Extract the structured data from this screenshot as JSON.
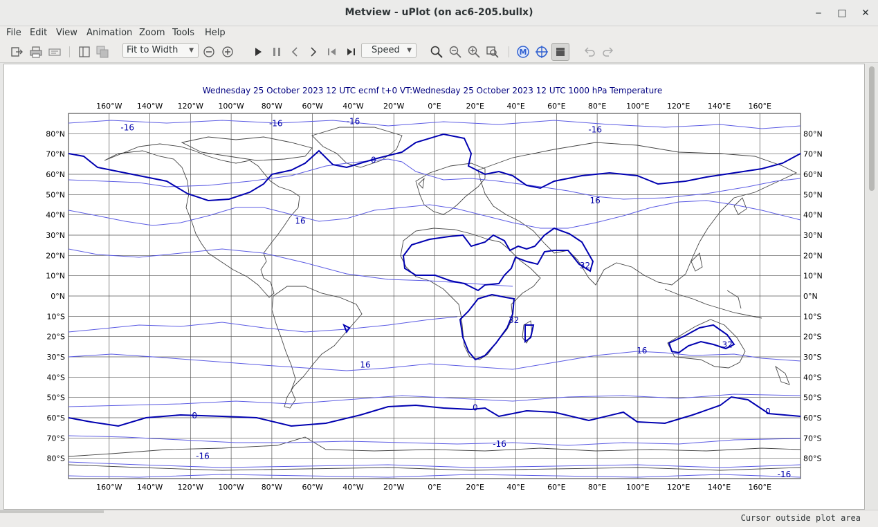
{
  "window": {
    "title": "Metview - uPlot (on ac6-205.bullx)",
    "minimize_glyph": "‒",
    "maximize_glyph": "□",
    "close_glyph": "✕"
  },
  "menu": {
    "items": [
      "File",
      "Edit",
      "View",
      "Animation",
      "Zoom",
      "Tools",
      "Help"
    ]
  },
  "toolbar": {
    "zoom_mode": "Fit to Width",
    "speed_label": "Speed",
    "icons": [
      "export-icon",
      "print-icon",
      "print-preview-icon",
      "layout-icon",
      "overlay-icon",
      "zoom-out-circle-icon",
      "zoom-in-circle-icon",
      "play-icon",
      "pause-icon",
      "previous-icon",
      "next-icon",
      "first-icon",
      "last-icon",
      "magnifier-icon",
      "zoom-out-icon",
      "zoom-in-icon",
      "zoom-stack-icon",
      "magics-icon",
      "cursor-data-icon",
      "data-layer-icon",
      "undo-icon",
      "redo-icon"
    ]
  },
  "plot": {
    "title": "Wednesday 25 October 2023 12 UTC ecmf t+0 VT:Wednesday 25 October 2023 12 UTC 1000 hPa  Temperature",
    "lon_labels": [
      "160°W",
      "140°W",
      "120°W",
      "100°W",
      "80°W",
      "60°W",
      "40°W",
      "20°W",
      "0°E",
      "20°E",
      "40°E",
      "60°E",
      "80°E",
      "100°E",
      "120°E",
      "140°E",
      "160°E"
    ],
    "lat_labels": [
      "80°N",
      "70°N",
      "60°N",
      "50°N",
      "40°N",
      "30°N",
      "20°N",
      "10°N",
      "0°N",
      "10°S",
      "20°S",
      "30°S",
      "40°S",
      "50°S",
      "60°S",
      "70°S",
      "80°S"
    ],
    "contour_labels": [
      {
        "text": "-16",
        "lon": -151,
        "lat": 83
      },
      {
        "text": "-16",
        "lon": -78,
        "lat": 85
      },
      {
        "text": "-16",
        "lon": -40,
        "lat": 86
      },
      {
        "text": "-16",
        "lon": 79,
        "lat": 82
      },
      {
        "text": "0",
        "lon": -30,
        "lat": 67
      },
      {
        "text": "16",
        "lon": -66,
        "lat": 37
      },
      {
        "text": "16",
        "lon": 79,
        "lat": 47
      },
      {
        "text": "32",
        "lon": 74,
        "lat": 15
      },
      {
        "text": "32",
        "lon": 39,
        "lat": -12
      },
      {
        "text": "32",
        "lon": 144,
        "lat": -24
      },
      {
        "text": "16",
        "lon": -34,
        "lat": -34
      },
      {
        "text": "16",
        "lon": 102,
        "lat": -27
      },
      {
        "text": "0",
        "lon": -118,
        "lat": -59
      },
      {
        "text": "0",
        "lon": 20,
        "lat": -55
      },
      {
        "text": "0",
        "lon": 164,
        "lat": -57
      },
      {
        "text": "-16",
        "lon": 32,
        "lat": -73
      },
      {
        "text": "-16",
        "lon": -114,
        "lat": -79
      },
      {
        "text": "-16",
        "lon": 172,
        "lat": -88
      }
    ],
    "colors": {
      "contour": "#0000aa",
      "contour_light": "#5555e0",
      "coast": "#444444",
      "grid": "#333333",
      "title": "#000080"
    }
  },
  "status": {
    "text": "Cursor outside plot area"
  }
}
